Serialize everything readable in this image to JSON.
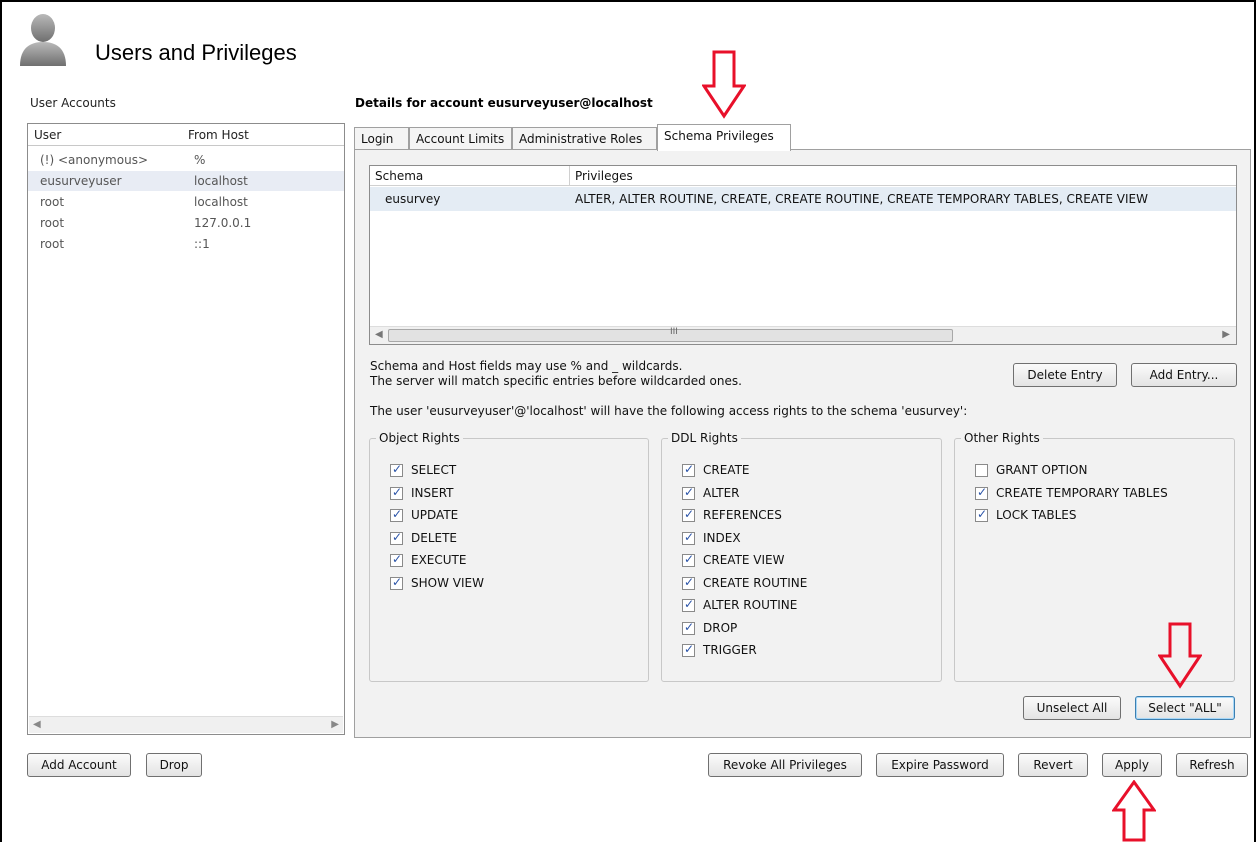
{
  "header": {
    "title": "Users and Privileges"
  },
  "accounts": {
    "section_label": "User Accounts",
    "columns": [
      "User",
      "From Host"
    ],
    "rows": [
      {
        "user": "(!) <anonymous>",
        "host": "%"
      },
      {
        "user": "eusurveyuser",
        "host": "localhost"
      },
      {
        "user": "root",
        "host": "localhost"
      },
      {
        "user": "root",
        "host": "127.0.0.1"
      },
      {
        "user": "root",
        "host": "::1"
      }
    ],
    "add_account_label": "Add Account",
    "drop_label": "Drop"
  },
  "details": {
    "title": "Details for account eusurveyuser@localhost",
    "tabs": [
      "Login",
      "Account Limits",
      "Administrative Roles",
      "Schema Privileges"
    ],
    "active_tab": "Schema Privileges",
    "table": {
      "columns": [
        "Schema",
        "Privileges"
      ],
      "rows": [
        {
          "schema": "eusurvey",
          "privileges": "ALTER, ALTER ROUTINE, CREATE, CREATE ROUTINE, CREATE TEMPORARY TABLES, CREATE VIEW"
        }
      ],
      "scroll_grip": "III"
    },
    "wildcard_note_1": "Schema and Host fields may use % and _ wildcards.",
    "wildcard_note_2": "The server will match specific entries before wildcarded ones.",
    "delete_entry_label": "Delete Entry",
    "add_entry_label": "Add Entry...",
    "access_note": "The user 'eusurveyuser'@'localhost' will have the following access rights to the schema 'eusurvey':",
    "object_rights": {
      "title": "Object Rights",
      "items": [
        {
          "label": "SELECT",
          "checked": true
        },
        {
          "label": "INSERT",
          "checked": true
        },
        {
          "label": "UPDATE",
          "checked": true
        },
        {
          "label": "DELETE",
          "checked": true
        },
        {
          "label": "EXECUTE",
          "checked": true
        },
        {
          "label": "SHOW VIEW",
          "checked": true
        }
      ]
    },
    "ddl_rights": {
      "title": "DDL Rights",
      "items": [
        {
          "label": "CREATE",
          "checked": true
        },
        {
          "label": "ALTER",
          "checked": true
        },
        {
          "label": "REFERENCES",
          "checked": true
        },
        {
          "label": "INDEX",
          "checked": true
        },
        {
          "label": "CREATE VIEW",
          "checked": true
        },
        {
          "label": "CREATE ROUTINE",
          "checked": true
        },
        {
          "label": "ALTER ROUTINE",
          "checked": true
        },
        {
          "label": "DROP",
          "checked": true
        },
        {
          "label": "TRIGGER",
          "checked": true
        }
      ]
    },
    "other_rights": {
      "title": "Other Rights",
      "items": [
        {
          "label": "GRANT OPTION",
          "checked": false
        },
        {
          "label": "CREATE TEMPORARY TABLES",
          "checked": true
        },
        {
          "label": "LOCK TABLES",
          "checked": true
        }
      ]
    },
    "unselect_all_label": "Unselect All",
    "select_all_label": "Select \"ALL\""
  },
  "footer": {
    "revoke_label": "Revoke All Privileges",
    "expire_label": "Expire Password",
    "revert_label": "Revert",
    "apply_label": "Apply",
    "refresh_label": "Refresh"
  },
  "colors": {
    "annotation_arrow": "#e8102a",
    "selected_row": "#e8ecf4",
    "panel_bg": "#f2f2f2"
  }
}
